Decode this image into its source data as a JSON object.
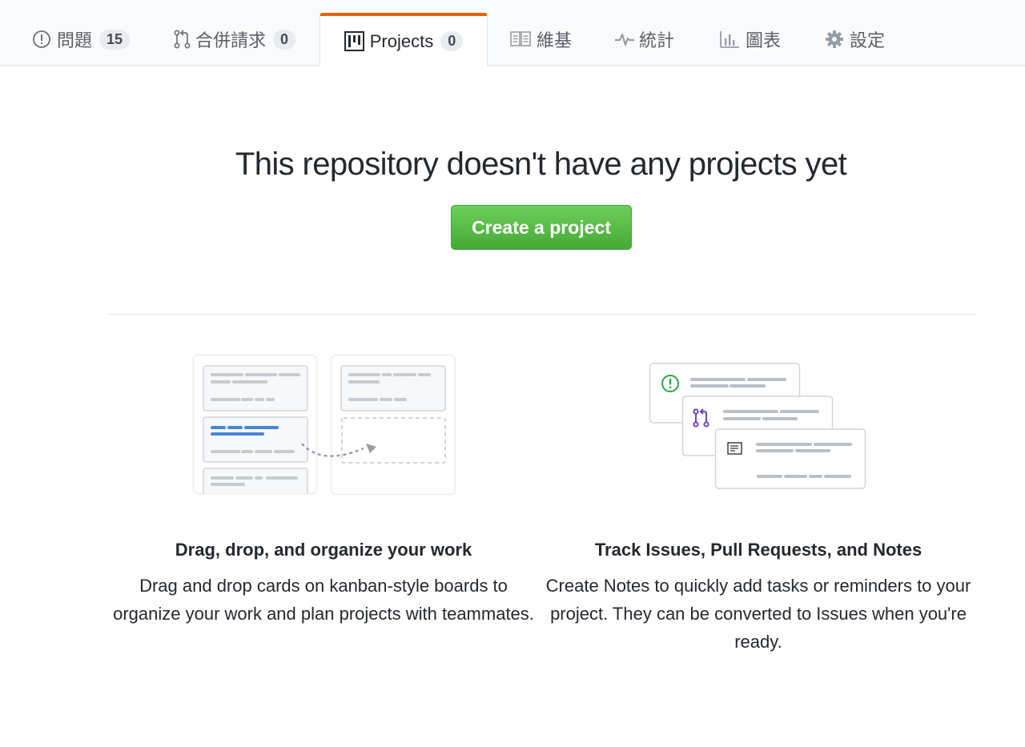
{
  "tabs": [
    {
      "label": "問題",
      "count": "15",
      "icon": "issue-opened-icon"
    },
    {
      "label": "合併請求",
      "count": "0",
      "icon": "git-pull-request-icon"
    },
    {
      "label": "Projects",
      "count": "0",
      "icon": "project-icon",
      "selected": true
    },
    {
      "label": "維基",
      "icon": "book-icon"
    },
    {
      "label": "統計",
      "icon": "pulse-icon"
    },
    {
      "label": "圖表",
      "icon": "graph-icon"
    },
    {
      "label": "設定",
      "icon": "gear-icon"
    }
  ],
  "blankslate": {
    "headline": "This repository doesn't have any projects yet",
    "create_button": "Create a project"
  },
  "features": [
    {
      "title": "Drag, drop, and organize your work",
      "text": "Drag and drop cards on kanban-style boards to organize your work and plan projects with teammates.",
      "illustration": "kanban-board-illustration"
    },
    {
      "title": "Track Issues, Pull Requests, and Notes",
      "text": "Create Notes to quickly add tasks or reminders to your project. They can be converted to Issues when you're ready.",
      "illustration": "cards-stack-illustration"
    }
  ],
  "colors": {
    "selected_tab_accent": "#e36209",
    "create_button": "#4cb83c",
    "issue_icon": "#28a745",
    "pull_request_icon": "#6f42c1",
    "card_highlight": "#4a86d6"
  }
}
